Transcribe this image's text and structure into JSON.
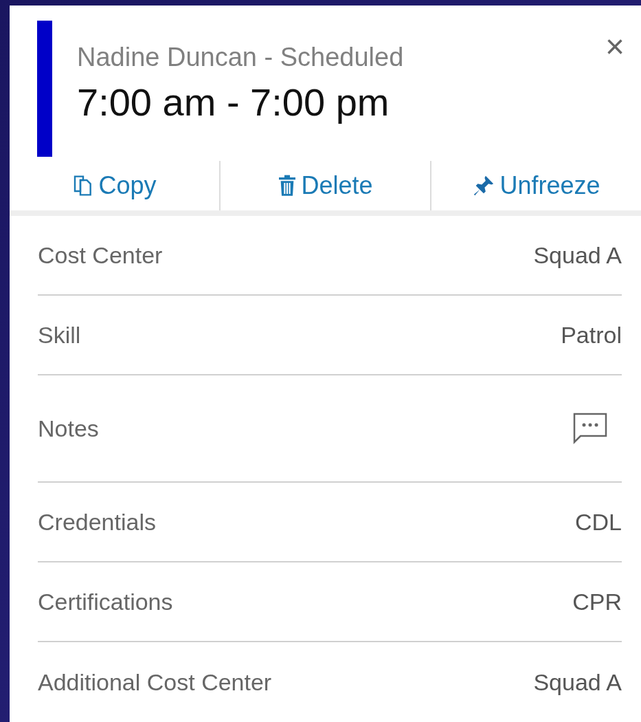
{
  "header": {
    "title": "Nadine Duncan - Scheduled",
    "time": "7:00 am - 7:00 pm",
    "color": "#0000c8",
    "close": "×"
  },
  "actions": [
    {
      "kind": "copy",
      "label": "Copy"
    },
    {
      "kind": "delete",
      "label": "Delete"
    },
    {
      "kind": "pin",
      "label": "Unfreeze"
    }
  ],
  "details": [
    {
      "kind": "text",
      "label": "Cost Center",
      "value": "Squad A"
    },
    {
      "kind": "text",
      "label": "Skill",
      "value": "Patrol"
    },
    {
      "kind": "notes",
      "label": "Notes"
    },
    {
      "kind": "text",
      "label": "Credentials",
      "value": "CDL"
    },
    {
      "kind": "text",
      "label": "Certifications",
      "value": "CPR"
    },
    {
      "kind": "text",
      "label": "Additional Cost Center",
      "value": "Squad A"
    }
  ]
}
